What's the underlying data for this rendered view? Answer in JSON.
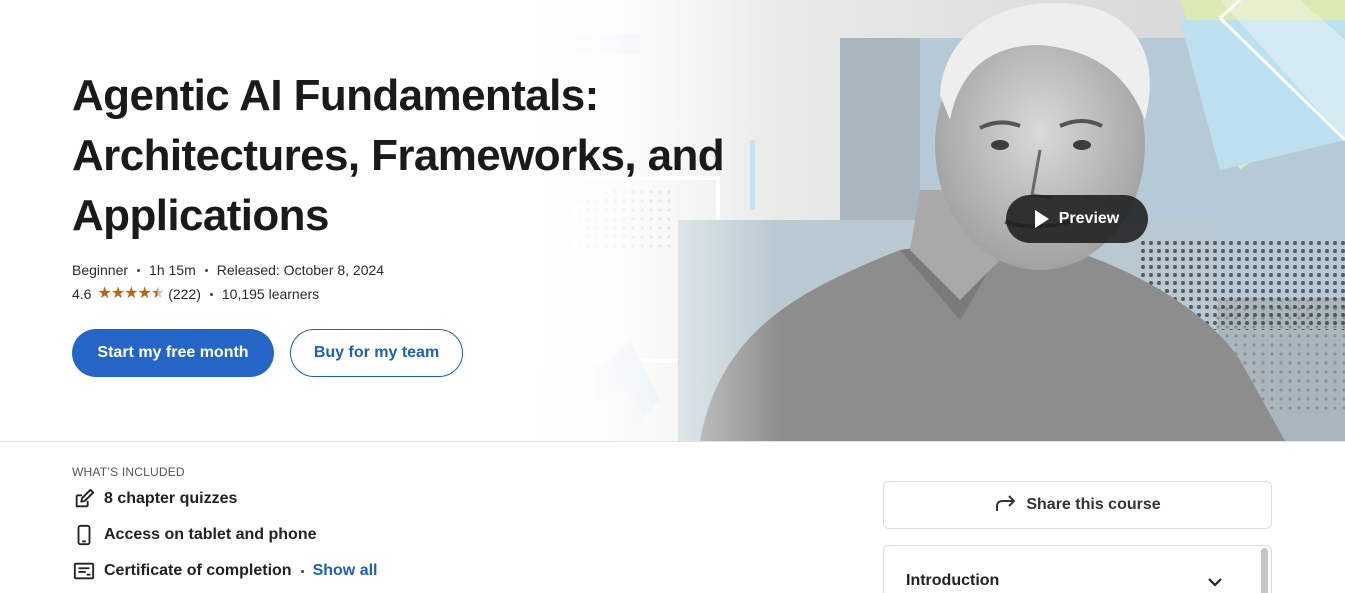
{
  "course": {
    "title": "Agentic AI Fundamentals: Architectures, Frameworks, and Applications",
    "level": "Beginner",
    "duration": "1h 15m",
    "released": "Released: October 8, 2024",
    "rating": "4.6",
    "rating_value": 4.6,
    "rating_count": "(222)",
    "learners": "10,195 learners"
  },
  "actions": {
    "primary_label": "Start my free month",
    "secondary_label": "Buy for my team",
    "preview_label": "Preview"
  },
  "included": {
    "heading": "WHAT’S INCLUDED",
    "items": [
      {
        "label": "8 chapter quizzes",
        "icon": "edit-icon"
      },
      {
        "label": "Access on tablet and phone",
        "icon": "phone-icon"
      },
      {
        "label": "Certificate of completion",
        "icon": "certificate-icon"
      }
    ],
    "show_all": "Show all"
  },
  "sidebar": {
    "share_label": "Share this course",
    "toc_first_chapter": "Introduction"
  },
  "colors": {
    "primary": "#2466c5",
    "link": "#1e5fb8",
    "star": "#b4690e"
  }
}
